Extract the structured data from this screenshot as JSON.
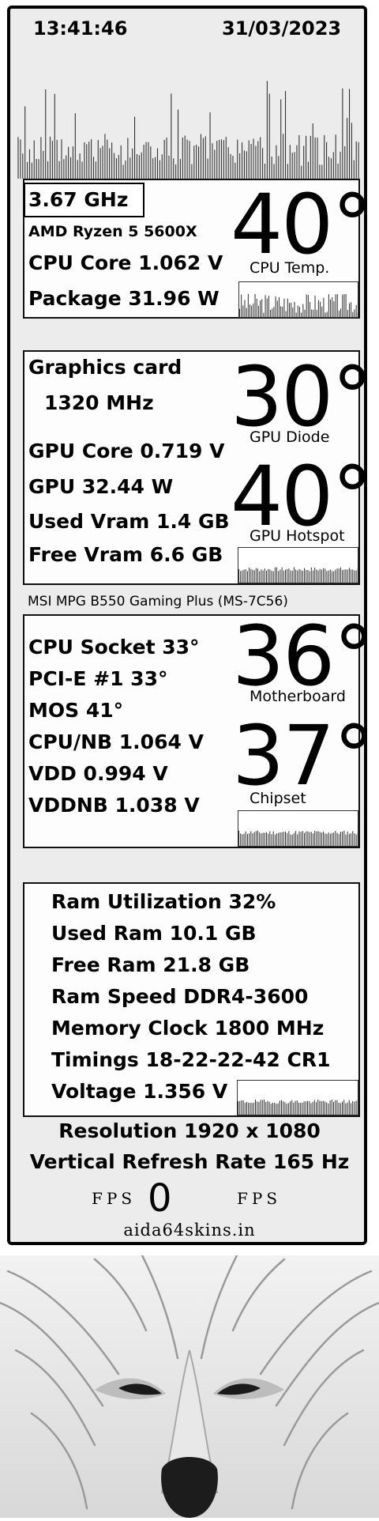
{
  "header": {
    "time": "13:41:46",
    "date": "31/03/2023"
  },
  "cpu": {
    "frequency": "3.67 GHz",
    "model": "AMD Ryzen 5 5600X",
    "core_voltage": "CPU Core 1.062 V",
    "package_power": "Package 31.96 W",
    "temp_value": "40°",
    "temp_label": "CPU Temp."
  },
  "gpu": {
    "title": "Graphics card",
    "clock": "1320 MHz",
    "core_voltage": "GPU Core 0.719 V",
    "power": "GPU 32.44 W",
    "used_vram": "Used Vram 1.4 GB",
    "free_vram": "Free Vram 6.6 GB",
    "diode_value": "30°",
    "diode_label": "GPU Diode",
    "hotspot_value": "40°",
    "hotspot_label": "GPU Hotspot"
  },
  "motherboard": {
    "name": "MSI MPG B550 Gaming Plus (MS-7C56)",
    "cpu_socket": "CPU Socket 33°",
    "pcie": "PCI-E #1 33°",
    "mos": "MOS 41°",
    "cpu_nb": "CPU/NB 1.064 V",
    "vdd": "VDD 0.994 V",
    "vddnb": "VDDNB 1.038 V",
    "mb_value": "36°",
    "mb_label": "Motherboard",
    "chipset_value": "37°",
    "chipset_label": "Chipset"
  },
  "ram": {
    "utilization": "Ram Utilization 32%",
    "used": "Used Ram 10.1 GB",
    "free": "Free Ram 21.8 GB",
    "speed": "Ram Speed DDR4-3600",
    "clock": "Memory Clock 1800 MHz",
    "timings": "Timings 18-22-22-42 CR1",
    "voltage": "Voltage 1.356 V"
  },
  "display": {
    "resolution": "Resolution 1920 x 1080",
    "refresh": "Vertical Refresh Rate 165 Hz",
    "fps_left": "FPS",
    "fps_value": "0",
    "fps_right": "FPS",
    "site": "aida64skins.in"
  },
  "icons": {
    "background_art": "wolf-face-icon"
  }
}
